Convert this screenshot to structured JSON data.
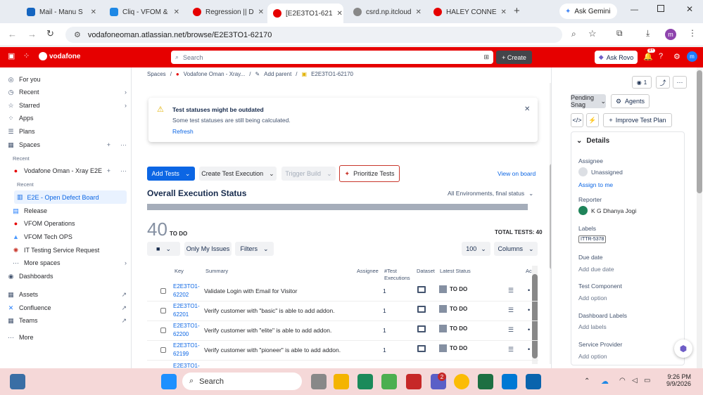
{
  "browser": {
    "tabs": [
      {
        "label": "Mail - Manu S",
        "color": "#1565c0"
      },
      {
        "label": "Cliq - VFOM &",
        "color": "#1e88e5"
      },
      {
        "label": "Regression || D",
        "color": "#e60000"
      },
      {
        "label": "[E2E3TO1-621",
        "color": "#e60000"
      },
      {
        "label": "csrd.np.itcloud",
        "color": "#888888"
      },
      {
        "label": "HALEY CONNE",
        "color": "#e60000"
      }
    ],
    "new_tab": "+",
    "gemini": "Ask Gemini",
    "url": "vodafoneoman.atlassian.net/browse/E2E3TO1-62170",
    "profile": "m"
  },
  "jira": {
    "brand": "vodafone",
    "search_placeholder": "Search",
    "create": "+ Create",
    "ask_rovo": "Ask Rovo",
    "notif_badge": "9+",
    "avatar": "m"
  },
  "sidebar": {
    "items": [
      {
        "label": "For you",
        "icon": "◎"
      },
      {
        "label": "Recent",
        "icon": "◷",
        "chev": "›"
      },
      {
        "label": "Starred",
        "icon": "☆",
        "chev": "›"
      },
      {
        "label": "Apps",
        "icon": "⁘"
      },
      {
        "label": "Plans",
        "icon": "☰"
      },
      {
        "label": "Spaces",
        "icon": "▦",
        "plus": "+",
        "more": "···"
      }
    ],
    "recent_heading": "Recent",
    "space_name": "Vodafone Oman - Xray E2E",
    "space_recent": "Recent",
    "active_item": "E2E - Open Defect Board",
    "spaces": [
      {
        "label": "Release",
        "color": "#1d7afc"
      },
      {
        "label": "VFOM Operations",
        "color": "#e60000"
      },
      {
        "label": "VFOM Tech OPS",
        "color": "#4c9aff"
      },
      {
        "label": "IT Testing Service Request",
        "color": "#c9372c"
      },
      {
        "label": "More spaces",
        "chev": "›"
      }
    ],
    "bottom": [
      {
        "label": "Dashboards",
        "icon": "◉"
      },
      {
        "label": "Assets",
        "icon": "▦",
        "ext": "↗"
      },
      {
        "label": "Confluence",
        "icon": "✕",
        "ext": "↗"
      },
      {
        "label": "Teams",
        "icon": "▦",
        "ext": "↗"
      },
      {
        "label": "More",
        "icon": "···"
      }
    ]
  },
  "breadcrumb": {
    "spaces": "Spaces",
    "project": "Vodafone Oman - Xray...",
    "add_parent": "Add parent",
    "issue": "E2E3TO1-62170"
  },
  "alert": {
    "title": "Test statuses might be outdated",
    "body": "Some test statuses are still being calculated.",
    "refresh": "Refresh"
  },
  "toolbar": {
    "add_tests": "Add Tests",
    "create_exec": "Create Test Execution",
    "trigger": "Trigger Build",
    "prioritize": "Prioritize Tests",
    "view_board": "View on board"
  },
  "overall": {
    "title": "Overall Execution Status",
    "env": "All Environments, final status",
    "count": "40",
    "count_label": "TO DO",
    "total": "TOTAL TESTS: 40",
    "only_my": "Only My Issues",
    "filters": "Filters",
    "page_size": "100",
    "columns": "Columns"
  },
  "table": {
    "headers": [
      "Key",
      "Summary",
      "Assignee",
      "#Test Executions",
      "Dataset",
      "Latest Status",
      "Ac"
    ],
    "rows": [
      {
        "key1": "E2E3TO1-",
        "key2": "62202",
        "summary": "Validate Login with Email for Visitor",
        "exec": "1",
        "status": "TO DO"
      },
      {
        "key1": "E2E3TO1-",
        "key2": "62201",
        "summary": "Verify customer with \"basic\" is able to add addon.",
        "exec": "1",
        "status": "TO DO"
      },
      {
        "key1": "E2E3TO1-",
        "key2": "62200",
        "summary": "Verify customer with \"elite\" is able to add addon.",
        "exec": "1",
        "status": "TO DO"
      },
      {
        "key1": "E2E3TO1-",
        "key2": "62199",
        "summary": "Verify customer with \"pioneer\" is able to add addon.",
        "exec": "1",
        "status": "TO DO"
      },
      {
        "key1": "E2E3TO1-",
        "key2": "",
        "summary": "",
        "exec": "",
        "status": ""
      }
    ]
  },
  "right": {
    "watchers": "1",
    "status_btn": "Pending Snag",
    "agents": "Agents",
    "improve": "Improve Test Plan",
    "details": "Details",
    "assignee_label": "Assignee",
    "assignee": "Unassigned",
    "assign_me": "Assign to me",
    "reporter_label": "Reporter",
    "reporter": "K G Dhanya Jogi",
    "labels_label": "Labels",
    "label_tag": "ITTR-5378",
    "due_label": "Due date",
    "due": "Add due date",
    "component_label": "Test Component",
    "component": "Add option",
    "dash_label": "Dashboard Labels",
    "dash": "Add labels",
    "provider_label": "Service Provider",
    "provider": "Add option"
  },
  "taskbar": {
    "search": "Search",
    "teams_badge": "2",
    "time": "9:26 PM",
    "date": "9/9/2026"
  }
}
